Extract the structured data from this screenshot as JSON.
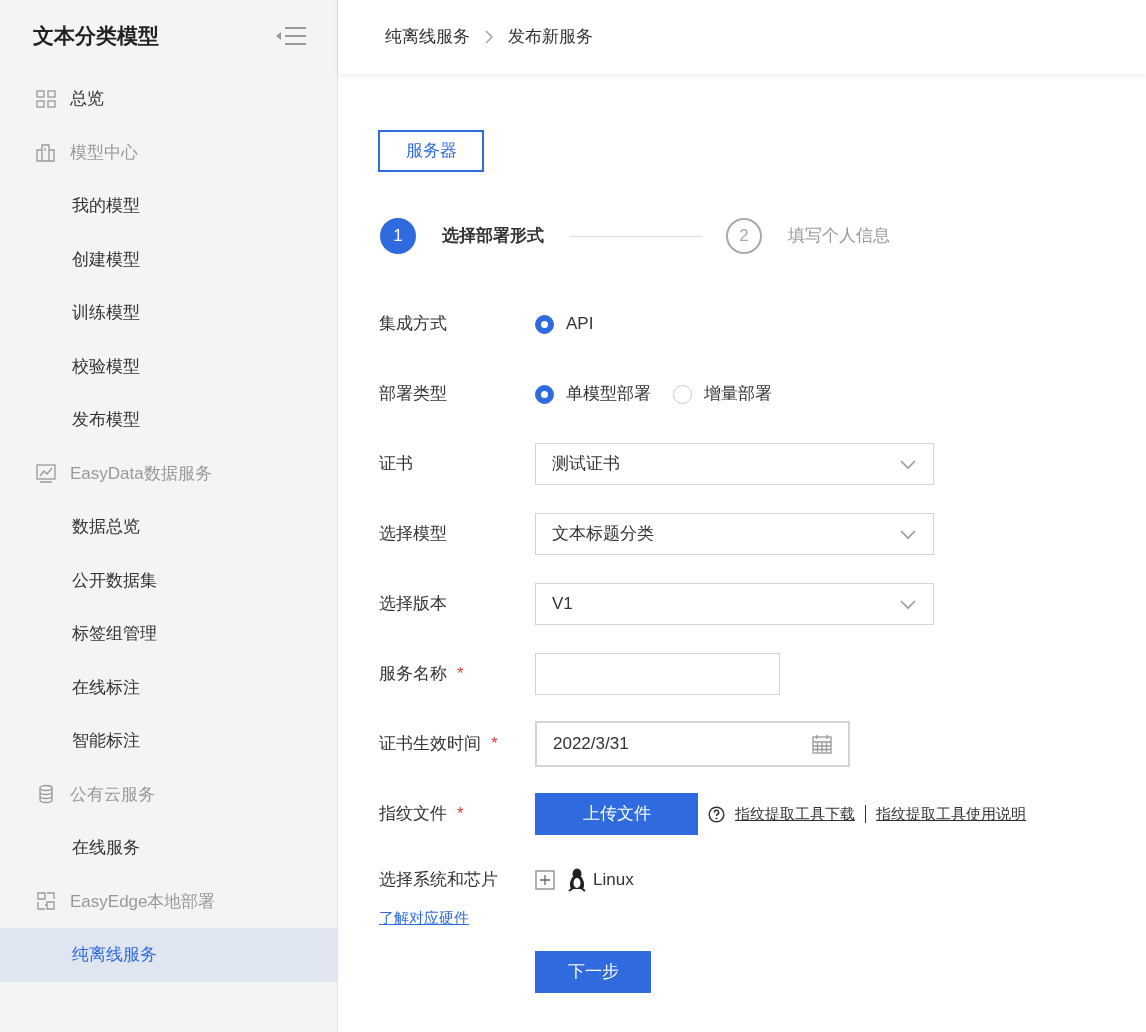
{
  "sidebar": {
    "title": "文本分类模型",
    "items": [
      {
        "kind": "top",
        "label": "总览",
        "selected": false
      },
      {
        "kind": "group",
        "label": "模型中心",
        "selected": false
      },
      {
        "kind": "link",
        "label": "我的模型",
        "selected": false
      },
      {
        "kind": "link",
        "label": "创建模型",
        "selected": false
      },
      {
        "kind": "link",
        "label": "训练模型",
        "selected": false
      },
      {
        "kind": "link",
        "label": "校验模型",
        "selected": false
      },
      {
        "kind": "link",
        "label": "发布模型",
        "selected": false
      },
      {
        "kind": "group",
        "label": "EasyData数据服务",
        "selected": false
      },
      {
        "kind": "link",
        "label": "数据总览",
        "selected": false
      },
      {
        "kind": "link",
        "label": "公开数据集",
        "selected": false
      },
      {
        "kind": "link",
        "label": "标签组管理",
        "selected": false
      },
      {
        "kind": "link",
        "label": "在线标注",
        "selected": false
      },
      {
        "kind": "link",
        "label": "智能标注",
        "selected": false
      },
      {
        "kind": "group",
        "label": "公有云服务",
        "selected": false
      },
      {
        "kind": "link",
        "label": "在线服务",
        "selected": false
      },
      {
        "kind": "group",
        "label": "EasyEdge本地部署",
        "selected": false
      },
      {
        "kind": "link",
        "label": "纯离线服务",
        "selected": true
      }
    ]
  },
  "breadcrumb": [
    "纯离线服务",
    "发布新服务"
  ],
  "tabs": [
    {
      "label": "服务器",
      "selected": true
    }
  ],
  "steps": [
    {
      "number": "1",
      "label": "选择部署形式",
      "selected": true
    },
    {
      "number": "2",
      "label": "填写个人信息",
      "selected": false
    }
  ],
  "form": [
    {
      "kind": "radio",
      "label": "集成方式",
      "options": [
        {
          "label": "API",
          "selected": true
        }
      ]
    },
    {
      "kind": "radio",
      "label": "部署类型",
      "options": [
        {
          "label": "单模型部署",
          "selected": true
        },
        {
          "label": "增量部署",
          "selected": false
        }
      ]
    },
    {
      "kind": "select",
      "label": "证书",
      "value": "测试证书"
    },
    {
      "kind": "select",
      "label": "选择模型",
      "value": "文本标题分类"
    },
    {
      "kind": "select",
      "label": "选择版本",
      "value": "V1"
    },
    {
      "kind": "text",
      "label": "服务名称",
      "required_mark": "*"
    },
    {
      "kind": "date",
      "label": "证书生效时间",
      "required_mark": "*",
      "value": "2022/3/31"
    },
    {
      "kind": "upload",
      "label": "指纹文件",
      "required_mark": "*",
      "button": "上传文件",
      "links": [
        "指纹提取工具下载",
        "指纹提取工具使用说明"
      ]
    },
    {
      "kind": "system",
      "label": "选择系统和芯片",
      "link": "了解对应硬件",
      "options": [
        "Linux"
      ]
    }
  ],
  "next_button": "下一步"
}
